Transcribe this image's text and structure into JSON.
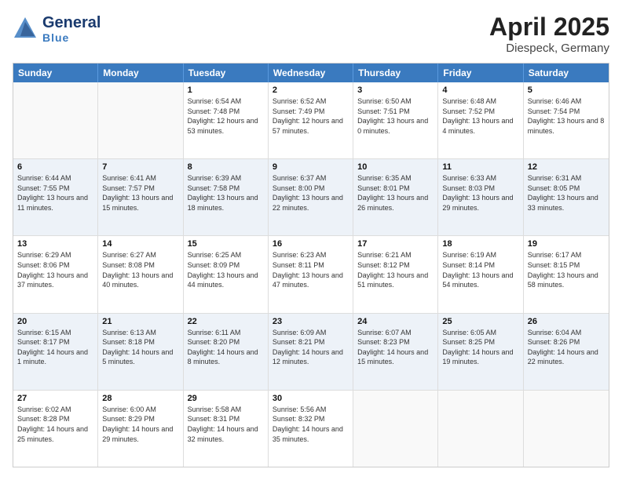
{
  "header": {
    "logo_general": "General",
    "logo_blue": "Blue",
    "month_title": "April 2025",
    "location": "Diespeck, Germany"
  },
  "days_of_week": [
    "Sunday",
    "Monday",
    "Tuesday",
    "Wednesday",
    "Thursday",
    "Friday",
    "Saturday"
  ],
  "weeks": [
    [
      {
        "day": "",
        "sunrise": "",
        "sunset": "",
        "daylight": ""
      },
      {
        "day": "",
        "sunrise": "",
        "sunset": "",
        "daylight": ""
      },
      {
        "day": "1",
        "sunrise": "Sunrise: 6:54 AM",
        "sunset": "Sunset: 7:48 PM",
        "daylight": "Daylight: 12 hours and 53 minutes."
      },
      {
        "day": "2",
        "sunrise": "Sunrise: 6:52 AM",
        "sunset": "Sunset: 7:49 PM",
        "daylight": "Daylight: 12 hours and 57 minutes."
      },
      {
        "day": "3",
        "sunrise": "Sunrise: 6:50 AM",
        "sunset": "Sunset: 7:51 PM",
        "daylight": "Daylight: 13 hours and 0 minutes."
      },
      {
        "day": "4",
        "sunrise": "Sunrise: 6:48 AM",
        "sunset": "Sunset: 7:52 PM",
        "daylight": "Daylight: 13 hours and 4 minutes."
      },
      {
        "day": "5",
        "sunrise": "Sunrise: 6:46 AM",
        "sunset": "Sunset: 7:54 PM",
        "daylight": "Daylight: 13 hours and 8 minutes."
      }
    ],
    [
      {
        "day": "6",
        "sunrise": "Sunrise: 6:44 AM",
        "sunset": "Sunset: 7:55 PM",
        "daylight": "Daylight: 13 hours and 11 minutes."
      },
      {
        "day": "7",
        "sunrise": "Sunrise: 6:41 AM",
        "sunset": "Sunset: 7:57 PM",
        "daylight": "Daylight: 13 hours and 15 minutes."
      },
      {
        "day": "8",
        "sunrise": "Sunrise: 6:39 AM",
        "sunset": "Sunset: 7:58 PM",
        "daylight": "Daylight: 13 hours and 18 minutes."
      },
      {
        "day": "9",
        "sunrise": "Sunrise: 6:37 AM",
        "sunset": "Sunset: 8:00 PM",
        "daylight": "Daylight: 13 hours and 22 minutes."
      },
      {
        "day": "10",
        "sunrise": "Sunrise: 6:35 AM",
        "sunset": "Sunset: 8:01 PM",
        "daylight": "Daylight: 13 hours and 26 minutes."
      },
      {
        "day": "11",
        "sunrise": "Sunrise: 6:33 AM",
        "sunset": "Sunset: 8:03 PM",
        "daylight": "Daylight: 13 hours and 29 minutes."
      },
      {
        "day": "12",
        "sunrise": "Sunrise: 6:31 AM",
        "sunset": "Sunset: 8:05 PM",
        "daylight": "Daylight: 13 hours and 33 minutes."
      }
    ],
    [
      {
        "day": "13",
        "sunrise": "Sunrise: 6:29 AM",
        "sunset": "Sunset: 8:06 PM",
        "daylight": "Daylight: 13 hours and 37 minutes."
      },
      {
        "day": "14",
        "sunrise": "Sunrise: 6:27 AM",
        "sunset": "Sunset: 8:08 PM",
        "daylight": "Daylight: 13 hours and 40 minutes."
      },
      {
        "day": "15",
        "sunrise": "Sunrise: 6:25 AM",
        "sunset": "Sunset: 8:09 PM",
        "daylight": "Daylight: 13 hours and 44 minutes."
      },
      {
        "day": "16",
        "sunrise": "Sunrise: 6:23 AM",
        "sunset": "Sunset: 8:11 PM",
        "daylight": "Daylight: 13 hours and 47 minutes."
      },
      {
        "day": "17",
        "sunrise": "Sunrise: 6:21 AM",
        "sunset": "Sunset: 8:12 PM",
        "daylight": "Daylight: 13 hours and 51 minutes."
      },
      {
        "day": "18",
        "sunrise": "Sunrise: 6:19 AM",
        "sunset": "Sunset: 8:14 PM",
        "daylight": "Daylight: 13 hours and 54 minutes."
      },
      {
        "day": "19",
        "sunrise": "Sunrise: 6:17 AM",
        "sunset": "Sunset: 8:15 PM",
        "daylight": "Daylight: 13 hours and 58 minutes."
      }
    ],
    [
      {
        "day": "20",
        "sunrise": "Sunrise: 6:15 AM",
        "sunset": "Sunset: 8:17 PM",
        "daylight": "Daylight: 14 hours and 1 minute."
      },
      {
        "day": "21",
        "sunrise": "Sunrise: 6:13 AM",
        "sunset": "Sunset: 8:18 PM",
        "daylight": "Daylight: 14 hours and 5 minutes."
      },
      {
        "day": "22",
        "sunrise": "Sunrise: 6:11 AM",
        "sunset": "Sunset: 8:20 PM",
        "daylight": "Daylight: 14 hours and 8 minutes."
      },
      {
        "day": "23",
        "sunrise": "Sunrise: 6:09 AM",
        "sunset": "Sunset: 8:21 PM",
        "daylight": "Daylight: 14 hours and 12 minutes."
      },
      {
        "day": "24",
        "sunrise": "Sunrise: 6:07 AM",
        "sunset": "Sunset: 8:23 PM",
        "daylight": "Daylight: 14 hours and 15 minutes."
      },
      {
        "day": "25",
        "sunrise": "Sunrise: 6:05 AM",
        "sunset": "Sunset: 8:25 PM",
        "daylight": "Daylight: 14 hours and 19 minutes."
      },
      {
        "day": "26",
        "sunrise": "Sunrise: 6:04 AM",
        "sunset": "Sunset: 8:26 PM",
        "daylight": "Daylight: 14 hours and 22 minutes."
      }
    ],
    [
      {
        "day": "27",
        "sunrise": "Sunrise: 6:02 AM",
        "sunset": "Sunset: 8:28 PM",
        "daylight": "Daylight: 14 hours and 25 minutes."
      },
      {
        "day": "28",
        "sunrise": "Sunrise: 6:00 AM",
        "sunset": "Sunset: 8:29 PM",
        "daylight": "Daylight: 14 hours and 29 minutes."
      },
      {
        "day": "29",
        "sunrise": "Sunrise: 5:58 AM",
        "sunset": "Sunset: 8:31 PM",
        "daylight": "Daylight: 14 hours and 32 minutes."
      },
      {
        "day": "30",
        "sunrise": "Sunrise: 5:56 AM",
        "sunset": "Sunset: 8:32 PM",
        "daylight": "Daylight: 14 hours and 35 minutes."
      },
      {
        "day": "",
        "sunrise": "",
        "sunset": "",
        "daylight": ""
      },
      {
        "day": "",
        "sunrise": "",
        "sunset": "",
        "daylight": ""
      },
      {
        "day": "",
        "sunrise": "",
        "sunset": "",
        "daylight": ""
      }
    ]
  ],
  "alt_rows": [
    1,
    3
  ]
}
